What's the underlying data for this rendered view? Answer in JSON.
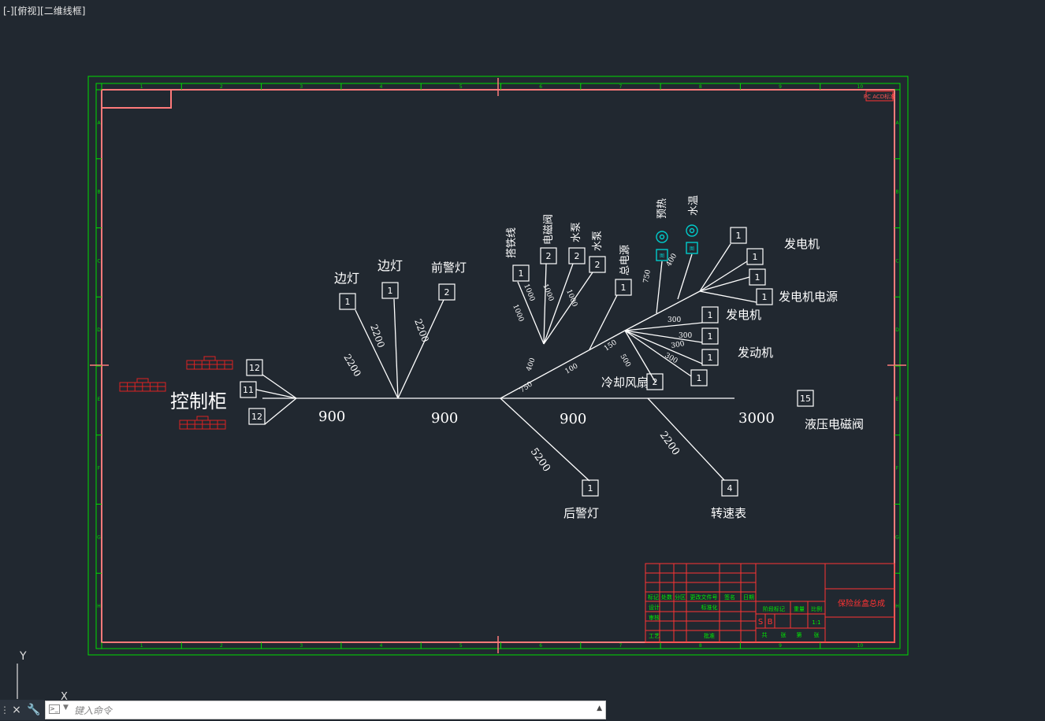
{
  "viewport_label": "[-][俯视][二维线框]",
  "command_line": {
    "placeholder": "键入命令",
    "close_icon": "×",
    "wrench_icon": "🔧",
    "grip": "⋮"
  },
  "ucs": {
    "y": "Y",
    "x": "X"
  },
  "colors": {
    "background": "#212830",
    "frame": "#00dd00",
    "border": "#ff7a7a",
    "wire": "#ffffff",
    "red_block": "#dd2222",
    "terminal": "#00cccc"
  },
  "drawing": {
    "grid_top": [
      "1",
      "2",
      "3",
      "4",
      "5",
      "6",
      "7",
      "8",
      "9",
      "10"
    ],
    "grid_side": [
      "A",
      "B",
      "C",
      "D",
      "E",
      "F",
      "G",
      "H"
    ],
    "corner_tag": "PC ACD标准",
    "control_cabinet": "控制柜",
    "trunk_lengths": [
      "900",
      "900",
      "900",
      "3000"
    ],
    "trunk_branches": [
      "750",
      "400",
      "100"
    ],
    "left_boxes": [
      "12",
      "11",
      "12"
    ],
    "edge_lamps": {
      "labels": [
        "边灯",
        "边灯",
        "前警灯"
      ],
      "boxes": [
        "1",
        "1",
        "2"
      ],
      "lengths": [
        "2200",
        "2200",
        "2200"
      ]
    },
    "upper_group": {
      "labels": [
        "搭铁线",
        "电磁阀",
        "水泵",
        "水泵",
        "总电源"
      ],
      "boxes": [
        "1",
        "2",
        "2",
        "2",
        "1"
      ],
      "lengths": [
        "1000",
        "1000",
        "1000",
        "1000"
      ]
    },
    "sensors": {
      "labels": [
        "预热",
        "水温"
      ],
      "lengths": [
        "750",
        "400"
      ]
    },
    "generator": {
      "labels": [
        "发电机",
        "发电机电源",
        "发电机"
      ],
      "boxes": [
        "1",
        "1",
        "1",
        "1"
      ]
    },
    "engine": {
      "label": "发动机",
      "boxes": [
        "1",
        "1",
        "1",
        "1"
      ],
      "lengths": [
        "300",
        "300",
        "300",
        "300"
      ],
      "extra_lengths": [
        "150",
        "500"
      ]
    },
    "cooling_fan": {
      "label": "冷却风扇",
      "box": "2"
    },
    "hydraulic_valve": {
      "label": "液压电磁阀",
      "box": "15"
    },
    "rear_lamp": {
      "label": "后警灯",
      "box": "1",
      "length": "5200"
    },
    "tachometer": {
      "label": "转速表",
      "box": "4",
      "length": "2200"
    },
    "title_block": {
      "title": "保险丝盒总成",
      "header_cells": [
        "标记",
        "处数",
        "分区",
        "更改文件号",
        "签名",
        "日期"
      ],
      "role_cells": [
        "设计",
        "标准化",
        "审核",
        "工艺",
        "批准"
      ],
      "info_cells": [
        "阶段标记",
        "重量",
        "比例"
      ],
      "scale": "1:1",
      "sheet_cells": [
        "共",
        "张",
        "第",
        "张"
      ],
      "stage": [
        "S",
        "B"
      ]
    }
  }
}
